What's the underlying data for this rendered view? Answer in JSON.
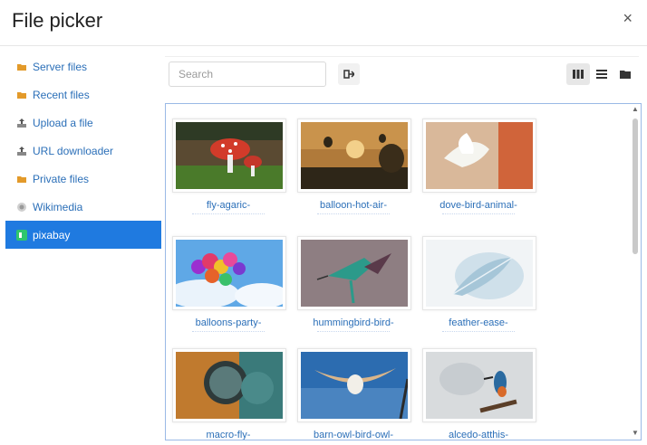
{
  "dialog": {
    "title": "File picker",
    "close_glyph": "×"
  },
  "sidebar": {
    "items": [
      {
        "label": "Server files",
        "icon": "folder-icon"
      },
      {
        "label": "Recent files",
        "icon": "folder-icon"
      },
      {
        "label": "Upload a file",
        "icon": "upload-icon"
      },
      {
        "label": "URL downloader",
        "icon": "upload-icon"
      },
      {
        "label": "Private files",
        "icon": "folder-icon"
      },
      {
        "label": "Wikimedia",
        "icon": "wikimedia-icon"
      },
      {
        "label": "pixabay",
        "icon": "pixabay-icon",
        "active": true
      }
    ]
  },
  "toolbar": {
    "search_placeholder": "Search",
    "refresh_icon": "logout-icon",
    "view_icons": [
      "grid-view-icon",
      "list-view-icon",
      "folder-view-icon"
    ],
    "active_view": "grid-view-icon"
  },
  "files": [
    {
      "name": "fly-agaric-",
      "thumb": "mushroom"
    },
    {
      "name": "balloon-hot-air-",
      "thumb": "balloon"
    },
    {
      "name": "dove-bird-animal-",
      "thumb": "dove"
    },
    {
      "name": "balloons-party-",
      "thumb": "balloons"
    },
    {
      "name": "hummingbird-bird-",
      "thumb": "hummingbird"
    },
    {
      "name": "feather-ease-",
      "thumb": "feather"
    },
    {
      "name": "macro-fly-",
      "thumb": "macro"
    },
    {
      "name": "barn-owl-bird-owl-",
      "thumb": "owl"
    },
    {
      "name": "alcedo-atthis-",
      "thumb": "kingfisher"
    }
  ],
  "colors": {
    "accent": "#1f7ae0",
    "link": "#2b6fb8"
  }
}
